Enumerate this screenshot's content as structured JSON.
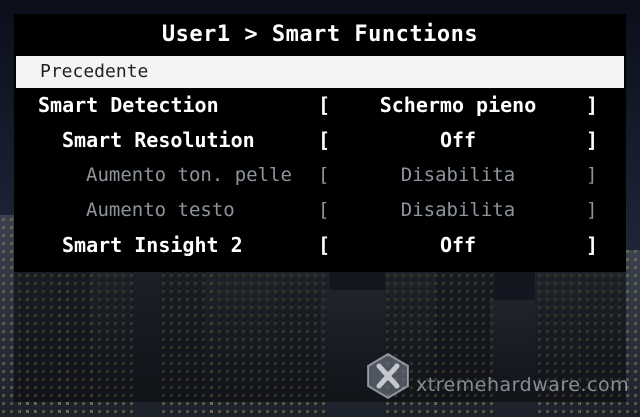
{
  "header": {
    "title": "User1 > Smart Functions"
  },
  "menu": {
    "back_label": "Precedente",
    "items": [
      {
        "label": "Smart Detection",
        "value": "Schermo pieno",
        "enabled": true
      },
      {
        "label": "Smart Resolution",
        "value": "Off",
        "enabled": true
      },
      {
        "label": "Aumento ton. pelle",
        "value": "Disabilita",
        "enabled": false
      },
      {
        "label": "Aumento testo",
        "value": "Disabilita",
        "enabled": false
      },
      {
        "label": "Smart Insight 2",
        "value": "Off",
        "enabled": true
      }
    ],
    "bracket_open": "[",
    "bracket_close": "]"
  },
  "watermark": {
    "text": "xtremehardware.com",
    "icon": "x-logo-icon"
  },
  "colors": {
    "highlight_bg": "#f4f4f6",
    "active_text": "#ffffff",
    "disabled_text": "#8e949c",
    "panel_bg": "#000000"
  }
}
